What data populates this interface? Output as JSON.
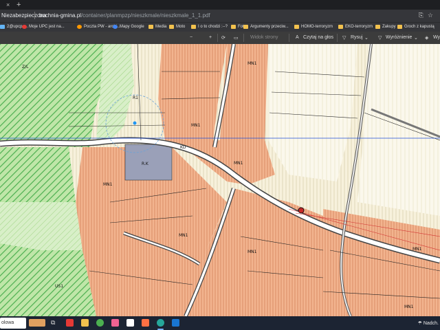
{
  "browser": {
    "tab_close": "×",
    "new_tab": "+",
    "security_label": "Niezabezpieczona",
    "url_host": "bochnia-gmina.pl",
    "url_path": "/container/planmpzp/nieszkmale/nieszkmale_1_1.pdf",
    "bookmarks": [
      {
        "label": "2@upcpo...",
        "icon": "link-icon"
      },
      {
        "label": "Moje UPC jest na...",
        "icon": "upc-icon"
      },
      {
        "label": "Poczta PW - archi...",
        "icon": "mail-icon"
      },
      {
        "label": "Mapy Google",
        "icon": "maps-icon"
      },
      {
        "label": "Media",
        "icon": "folder-icon"
      },
      {
        "label": "Moto",
        "icon": "folder-icon"
      },
      {
        "label": "I o to chodzi :--?",
        "icon": "folder-icon"
      },
      {
        "label": "Foto",
        "icon": "folder-icon"
      },
      {
        "label": "Argumenty przeciw...",
        "icon": "folder-icon"
      },
      {
        "label": "HOMO-terroryzm",
        "icon": "folder-icon"
      },
      {
        "label": "EKO-terroryzm",
        "icon": "folder-icon"
      },
      {
        "label": "Zakupy",
        "icon": "folder-icon"
      },
      {
        "label": "Groch z kapustą",
        "icon": "folder-icon"
      }
    ]
  },
  "pdf_toolbar": {
    "minus": "−",
    "plus": "+",
    "page_view": "Widok strony",
    "read_aloud": "Czytaj na głos",
    "draw": "Rysuj",
    "highlight": "Wyróżnienie",
    "more": "Wy"
  },
  "map_labels": {
    "zl": "Z/L",
    "r1_top": "R1",
    "mn1_a": "MN1",
    "mn1_b": "MN1",
    "mn1_c": "MN1",
    "mn1_d": "MN1",
    "mn1_e": "MN1",
    "mn1_f": "MN1",
    "mn1_g": "MN1",
    "mn1_h": "MN1",
    "rk": "R.K",
    "us1": "US1",
    "kd": "KD"
  },
  "taskbar": {
    "search_text": "olowa",
    "weather": "Nadch."
  },
  "colors": {
    "residential": "#f2b48f",
    "agricultural": "#f7f1dc",
    "forest": "#8fd46f",
    "green_zone": "#bfe6a8",
    "service": "#9aa0b8",
    "road": "#ffffff",
    "line": "#222222"
  }
}
